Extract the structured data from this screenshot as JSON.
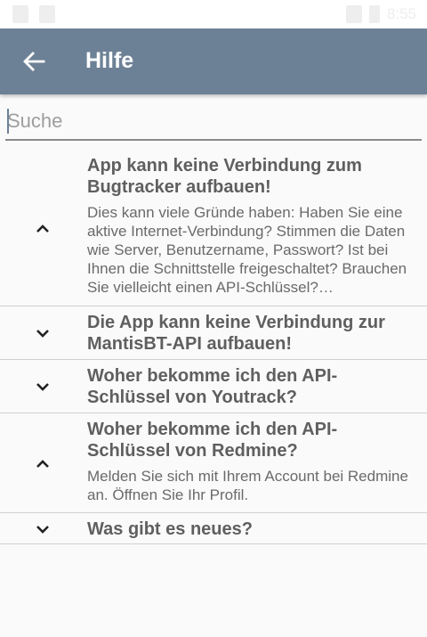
{
  "status_bar": {
    "time": "8:55"
  },
  "app_bar": {
    "title": "Hilfe",
    "back_icon": "arrow-left-icon"
  },
  "search": {
    "placeholder": "Suche",
    "value": ""
  },
  "faq": [
    {
      "title": "App kann keine Verbindung zum Bugtracker aufbauen!",
      "expanded": true,
      "answer": "Dies kann viele Gründe haben: Haben Sie eine aktive Internet-Verbindung? Stimmen die Daten wie Server, Benutzername, Passwort? Ist bei Ihnen die Schnittstelle freigeschaltet? Brauchen Sie vielleicht einen API-Schlüssel?…"
    },
    {
      "title": "Die App kann keine Verbindung zur MantisBT-API aufbauen!",
      "expanded": false
    },
    {
      "title": "Woher bekomme ich den API-Schlüssel von Youtrack?",
      "expanded": false
    },
    {
      "title": "Woher bekomme ich den API-Schlüssel von Redmine?",
      "expanded": true,
      "answer": "Melden Sie sich mit Ihrem Account bei Redmine an. Öffnen Sie Ihr Profil."
    },
    {
      "title": "Was gibt es neues?",
      "expanded": false
    }
  ]
}
